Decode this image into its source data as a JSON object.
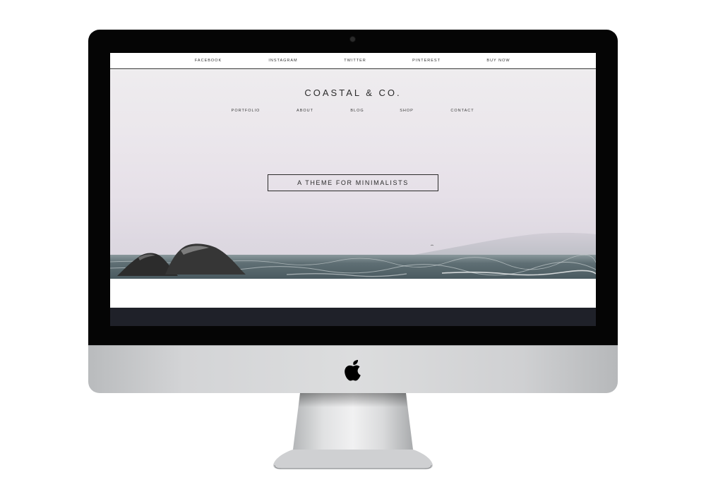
{
  "topbar": {
    "links": [
      "FACEBOOK",
      "INSTAGRAM",
      "TWITTER",
      "PINTEREST",
      "BUY NOW"
    ]
  },
  "site": {
    "title": "COASTAL & CO."
  },
  "nav": {
    "items": [
      "PORTFOLIO",
      "ABOUT",
      "BLOG",
      "SHOP",
      "CONTACT"
    ]
  },
  "hero": {
    "button_label": "A THEME FOR MINIMALISTS"
  },
  "colors": {
    "bezel": "#050505",
    "footer": "#1f2129",
    "sky": "#ebe7ec",
    "sea": "#5a6b70",
    "text": "#2b2b2b"
  },
  "icons": {
    "device_logo": "apple-logo-icon",
    "camera": "camera-icon"
  }
}
